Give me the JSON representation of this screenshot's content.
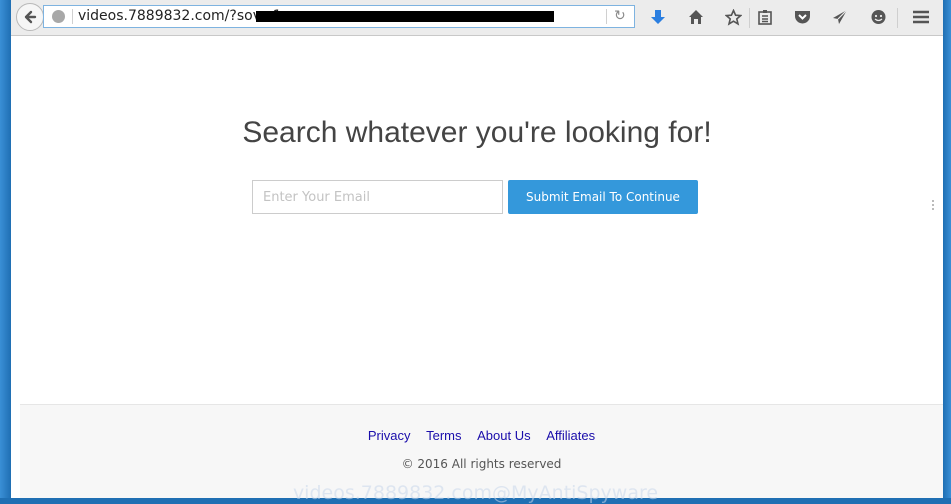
{
  "browser": {
    "url": "videos.7889832.com/?sov=1",
    "url_redacted": true,
    "toolbar_icons": [
      "downloads-icon",
      "home-icon",
      "bookmark-star-icon",
      "reading-list-icon",
      "pocket-icon",
      "share-icon",
      "chat-icon",
      "menu-icon"
    ]
  },
  "page": {
    "headline": "Search whatever you're looking for!",
    "email_placeholder": "Enter Your Email",
    "email_value": "",
    "submit_label": "Submit Email To Continue"
  },
  "footer": {
    "links": [
      {
        "label": "Privacy"
      },
      {
        "label": "Terms"
      },
      {
        "label": "About Us"
      },
      {
        "label": "Affiliates"
      }
    ],
    "copyright": "© 2016 All rights reserved"
  },
  "watermark": "videos.7889832.com@MyAntiSpyware",
  "colors": {
    "accent": "#3498db",
    "link": "#1a0dab",
    "download_icon": "#2a7ee0"
  }
}
